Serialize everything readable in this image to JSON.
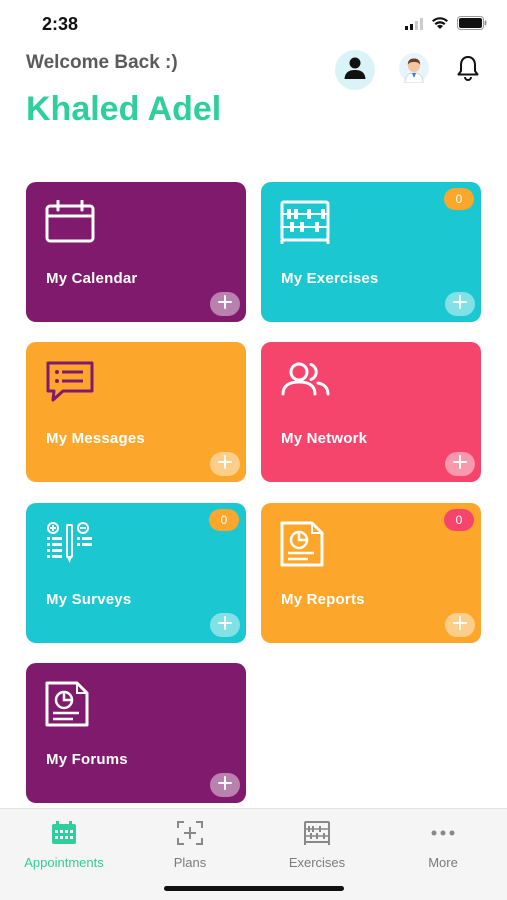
{
  "status": {
    "time": "2:38"
  },
  "header": {
    "welcome": "Welcome Back :)",
    "user_name": "Khaled Adel"
  },
  "colors": {
    "accent": "#2ecf9a",
    "purple": "#801a6c",
    "teal": "#1bc8d2",
    "orange": "#fca72b",
    "pink": "#f6456c"
  },
  "cards": [
    {
      "label": "My Calendar",
      "icon": "calendar-icon",
      "color": "#801a6c"
    },
    {
      "label": "My Exercises",
      "icon": "abacus-icon",
      "color": "#1bc8d2",
      "badge": "0"
    },
    {
      "label": "My Messages",
      "icon": "message-icon",
      "color": "#fca72b"
    },
    {
      "label": "My Network",
      "icon": "users-icon",
      "color": "#f6456c"
    },
    {
      "label": "My Surveys",
      "icon": "survey-icon",
      "color": "#1bc8d2",
      "badge": "0"
    },
    {
      "label": "My Reports",
      "icon": "report-icon",
      "color": "#fca72b",
      "badge": "0"
    },
    {
      "label": "My Forums",
      "icon": "forum-icon",
      "color": "#801a6c"
    }
  ],
  "tabs": [
    {
      "label": "Appointments",
      "icon": "calendar-grid-icon",
      "active": true
    },
    {
      "label": "Plans",
      "icon": "plans-icon",
      "active": false
    },
    {
      "label": "Exercises",
      "icon": "abacus-icon",
      "active": false
    },
    {
      "label": "More",
      "icon": "more-dots-icon",
      "active": false
    }
  ]
}
